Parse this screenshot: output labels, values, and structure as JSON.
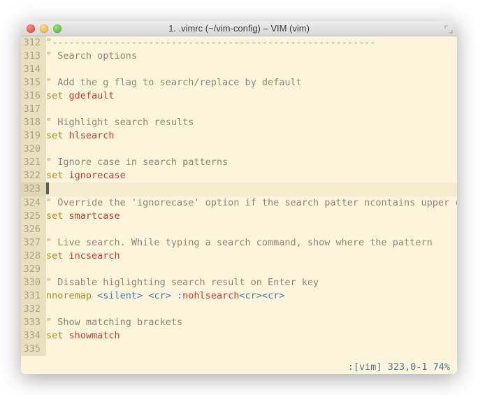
{
  "window": {
    "title": "1. .vimrc (~/vim-config) – VIM (vim)"
  },
  "editor": {
    "current_line": 323,
    "lines": [
      {
        "num": 312,
        "tokens": [
          [
            "tok-quote",
            "\""
          ],
          [
            "tok-comment",
            "---------------------------------------------------------"
          ]
        ]
      },
      {
        "num": 313,
        "tokens": [
          [
            "tok-quote",
            "\" "
          ],
          [
            "tok-comment",
            "Search options"
          ]
        ]
      },
      {
        "num": 314,
        "tokens": []
      },
      {
        "num": 315,
        "tokens": [
          [
            "tok-quote",
            "\" "
          ],
          [
            "tok-comment",
            "Add the g flag to search/replace by default"
          ]
        ]
      },
      {
        "num": 316,
        "tokens": [
          [
            "tok-set",
            "set "
          ],
          [
            "tok-opt",
            "gdefault"
          ]
        ]
      },
      {
        "num": 317,
        "tokens": []
      },
      {
        "num": 318,
        "tokens": [
          [
            "tok-quote",
            "\" "
          ],
          [
            "tok-comment",
            "Highlight search results"
          ]
        ]
      },
      {
        "num": 319,
        "tokens": [
          [
            "tok-set",
            "set "
          ],
          [
            "tok-opt",
            "hlsearch"
          ]
        ]
      },
      {
        "num": 320,
        "tokens": []
      },
      {
        "num": 321,
        "tokens": [
          [
            "tok-quote",
            "\" "
          ],
          [
            "tok-comment",
            "Ignore case in search patterns"
          ]
        ]
      },
      {
        "num": 322,
        "tokens": [
          [
            "tok-set",
            "set "
          ],
          [
            "tok-opt",
            "ignorecase"
          ]
        ]
      },
      {
        "num": 323,
        "tokens": [
          [
            "cursor",
            ""
          ]
        ]
      },
      {
        "num": 324,
        "tokens": [
          [
            "tok-quote",
            "\" "
          ],
          [
            "tok-comment",
            "Override the 'ignorecase' option if the search patter ncontains upper cas…"
          ]
        ]
      },
      {
        "num": 325,
        "tokens": [
          [
            "tok-set",
            "set "
          ],
          [
            "tok-opt",
            "smartcase"
          ]
        ]
      },
      {
        "num": 326,
        "tokens": []
      },
      {
        "num": 327,
        "tokens": [
          [
            "tok-quote",
            "\" "
          ],
          [
            "tok-comment",
            "Live search. While typing a search command, show where the pattern"
          ]
        ]
      },
      {
        "num": 328,
        "tokens": [
          [
            "tok-set",
            "set "
          ],
          [
            "tok-opt",
            "incsearch"
          ]
        ]
      },
      {
        "num": 329,
        "tokens": []
      },
      {
        "num": 330,
        "tokens": [
          [
            "tok-quote",
            "\" "
          ],
          [
            "tok-comment",
            "Disable higlighting search result on Enter key"
          ]
        ]
      },
      {
        "num": 331,
        "tokens": [
          [
            "tok-set",
            "nnoremap "
          ],
          [
            "tok-angle",
            "<silent>"
          ],
          [
            "",
            " "
          ],
          [
            "tok-angle",
            "<cr>"
          ],
          [
            "",
            " "
          ],
          [
            "tok-cmd",
            ":"
          ],
          [
            "tok-func",
            "nohlsearch"
          ],
          [
            "tok-angle",
            "<cr><cr>"
          ]
        ]
      },
      {
        "num": 332,
        "tokens": []
      },
      {
        "num": 333,
        "tokens": [
          [
            "tok-quote",
            "\" "
          ],
          [
            "tok-comment",
            "Show matching brackets"
          ]
        ]
      },
      {
        "num": 334,
        "tokens": [
          [
            "tok-set",
            "set "
          ],
          [
            "tok-opt",
            "showmatch"
          ]
        ]
      },
      {
        "num": 335,
        "tokens": []
      }
    ]
  },
  "status": {
    "text": ":[vim] 323,0-1 74%"
  }
}
